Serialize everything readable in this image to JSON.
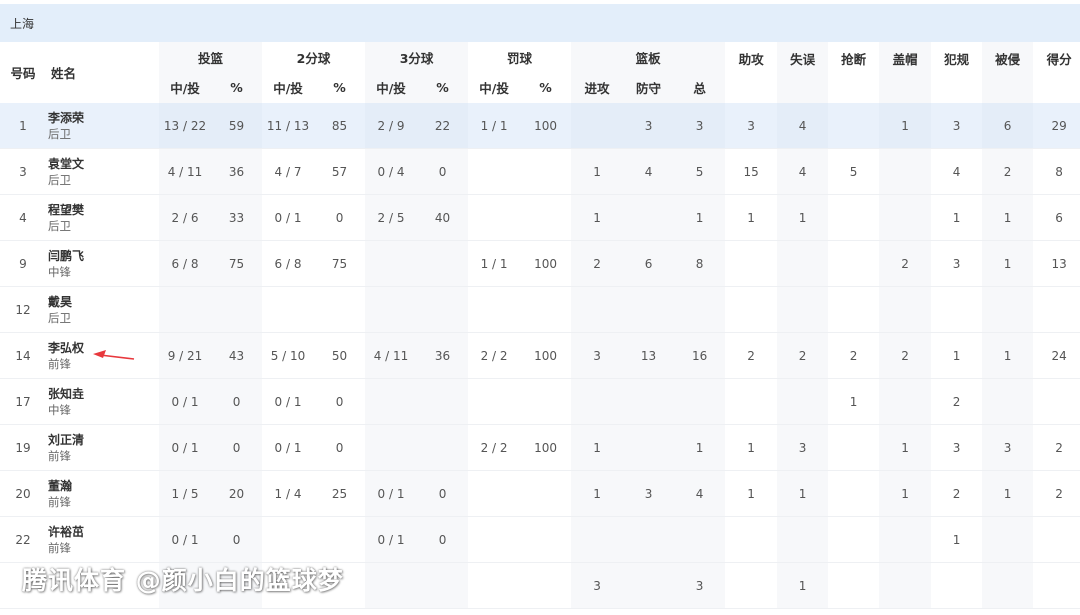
{
  "team": "上海",
  "headers": {
    "num": "号码",
    "name": "姓名",
    "groups": {
      "fg": "投篮",
      "two": "2分球",
      "three": "3分球",
      "ft": "罚球",
      "reb": "篮板"
    },
    "made_att": "中/投",
    "pct": "%",
    "oreb": "进攻",
    "dreb": "防守",
    "treb": "总",
    "ast": "助攻",
    "tov": "失误",
    "stl": "抢断",
    "blk": "盖帽",
    "pf": "犯规",
    "fd": "被侵",
    "pts": "得分"
  },
  "players": [
    {
      "num": "1",
      "name": "李添荣",
      "pos": "后卫",
      "fg": "13 / 22",
      "fgp": "59",
      "two": "11 / 13",
      "twop": "85",
      "three": "2 / 9",
      "threep": "22",
      "ft": "1 / 1",
      "ftp": "100",
      "oreb": "",
      "dreb": "3",
      "treb": "3",
      "ast": "3",
      "tov": "4",
      "stl": "",
      "blk": "1",
      "pf": "3",
      "fd": "6",
      "pts": "29"
    },
    {
      "num": "3",
      "name": "袁堂文",
      "pos": "后卫",
      "fg": "4 / 11",
      "fgp": "36",
      "two": "4 / 7",
      "twop": "57",
      "three": "0 / 4",
      "threep": "0",
      "ft": "",
      "ftp": "",
      "oreb": "1",
      "dreb": "4",
      "treb": "5",
      "ast": "15",
      "tov": "4",
      "stl": "5",
      "blk": "",
      "pf": "4",
      "fd": "2",
      "pts": "8"
    },
    {
      "num": "4",
      "name": "程望樊",
      "pos": "后卫",
      "fg": "2 / 6",
      "fgp": "33",
      "two": "0 / 1",
      "twop": "0",
      "three": "2 / 5",
      "threep": "40",
      "ft": "",
      "ftp": "",
      "oreb": "1",
      "dreb": "",
      "treb": "1",
      "ast": "1",
      "tov": "1",
      "stl": "",
      "blk": "",
      "pf": "1",
      "fd": "1",
      "pts": "6"
    },
    {
      "num": "9",
      "name": "闫鹏飞",
      "pos": "中锋",
      "fg": "6 / 8",
      "fgp": "75",
      "two": "6 / 8",
      "twop": "75",
      "three": "",
      "threep": "",
      "ft": "1 / 1",
      "ftp": "100",
      "oreb": "2",
      "dreb": "6",
      "treb": "8",
      "ast": "",
      "tov": "",
      "stl": "",
      "blk": "2",
      "pf": "3",
      "fd": "1",
      "pts": "13"
    },
    {
      "num": "12",
      "name": "戴昊",
      "pos": "后卫",
      "fg": "",
      "fgp": "",
      "two": "",
      "twop": "",
      "three": "",
      "threep": "",
      "ft": "",
      "ftp": "",
      "oreb": "",
      "dreb": "",
      "treb": "",
      "ast": "",
      "tov": "",
      "stl": "",
      "blk": "",
      "pf": "",
      "fd": "",
      "pts": ""
    },
    {
      "num": "14",
      "name": "李弘权",
      "pos": "前锋",
      "fg": "9 / 21",
      "fgp": "43",
      "two": "5 / 10",
      "twop": "50",
      "three": "4 / 11",
      "threep": "36",
      "ft": "2 / 2",
      "ftp": "100",
      "oreb": "3",
      "dreb": "13",
      "treb": "16",
      "ast": "2",
      "tov": "2",
      "stl": "2",
      "blk": "2",
      "pf": "1",
      "fd": "1",
      "pts": "24"
    },
    {
      "num": "17",
      "name": "张知垚",
      "pos": "中锋",
      "fg": "0 / 1",
      "fgp": "0",
      "two": "0 / 1",
      "twop": "0",
      "three": "",
      "threep": "",
      "ft": "",
      "ftp": "",
      "oreb": "",
      "dreb": "",
      "treb": "",
      "ast": "",
      "tov": "",
      "stl": "1",
      "blk": "",
      "pf": "2",
      "fd": "",
      "pts": ""
    },
    {
      "num": "19",
      "name": "刘正清",
      "pos": "前锋",
      "fg": "0 / 1",
      "fgp": "0",
      "two": "0 / 1",
      "twop": "0",
      "three": "",
      "threep": "",
      "ft": "2 / 2",
      "ftp": "100",
      "oreb": "1",
      "dreb": "",
      "treb": "1",
      "ast": "1",
      "tov": "3",
      "stl": "",
      "blk": "1",
      "pf": "3",
      "fd": "3",
      "pts": "2"
    },
    {
      "num": "20",
      "name": "董瀚",
      "pos": "前锋",
      "fg": "1 / 5",
      "fgp": "20",
      "two": "1 / 4",
      "twop": "25",
      "three": "0 / 1",
      "threep": "0",
      "ft": "",
      "ftp": "",
      "oreb": "1",
      "dreb": "3",
      "treb": "4",
      "ast": "1",
      "tov": "1",
      "stl": "",
      "blk": "1",
      "pf": "2",
      "fd": "1",
      "pts": "2"
    },
    {
      "num": "22",
      "name": "许裕茁",
      "pos": "前锋",
      "fg": "0 / 1",
      "fgp": "0",
      "two": "",
      "twop": "",
      "three": "0 / 1",
      "threep": "0",
      "ft": "",
      "ftp": "",
      "oreb": "",
      "dreb": "",
      "treb": "",
      "ast": "",
      "tov": "",
      "stl": "",
      "blk": "",
      "pf": "1",
      "fd": "",
      "pts": ""
    },
    {
      "num": "",
      "name": "",
      "pos": "",
      "fg": "",
      "fgp": "",
      "two": "",
      "twop": "",
      "three": "",
      "threep": "",
      "ft": "",
      "ftp": "",
      "oreb": "3",
      "dreb": "",
      "treb": "3",
      "ast": "",
      "tov": "1",
      "stl": "",
      "blk": "",
      "pf": "",
      "fd": "",
      "pts": ""
    }
  ],
  "watermark": "腾讯体育 @颜小白的篮球梦",
  "colors": {
    "header_bg": "#e3eefa",
    "selected_row": "#e9f1fb",
    "shaded_col": "#f7f8fa",
    "arrow": "#e8383d"
  }
}
